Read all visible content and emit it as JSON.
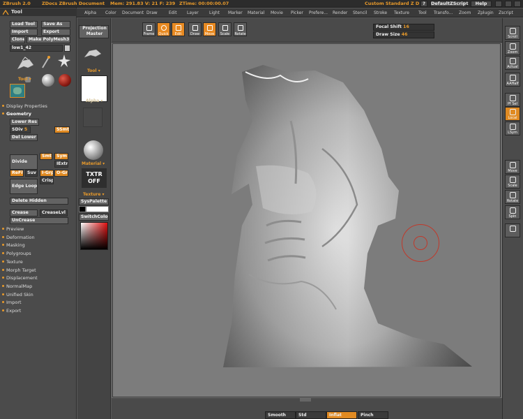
{
  "titlebar": {
    "app": "ZBrush 2.0",
    "doc_links": "ZDocs ZBrush Document",
    "mem": "Mem: 291.83  V: 21  F: 239",
    "ztime": "ZTime: 00:00:00.07",
    "custom": "Custom Standard Z D",
    "help_q": "?",
    "zscript": "DefaultZScript",
    "help": "Help"
  },
  "menu": [
    "Alpha",
    "Color",
    "Document",
    "Draw",
    "Edit",
    "Layer",
    "Light",
    "Marker",
    "Material",
    "Movie",
    "Picker",
    "Prefere...",
    "Render",
    "Stencil",
    "Stroke",
    "Texture",
    "Tool",
    "Transfo...",
    "Zoom",
    "Zplugin",
    "Zscript"
  ],
  "tool": {
    "title": "Tool",
    "load": "Load Tool",
    "save": "Save As",
    "import": "Import",
    "export": "Export",
    "clone": "Clone",
    "make_poly": "Make PolyMesh3D",
    "current_tool": "low1_42",
    "sections_top": [
      "Display Properties",
      "Geometry"
    ],
    "lower_res": "Lower Res",
    "sdiv_label": "SDiv",
    "sdiv_value": "5",
    "smt": "SSmt",
    "del_lower": "Del Lower",
    "divide": "Divide",
    "smt_btn": "Smt",
    "sym": "Sym",
    "iextr": "IExtr",
    "refit": "ReFit",
    "suv": "Suv",
    "igrp": "I-Grp",
    "ogrp": "O-Grp",
    "edge_loop": "Edge Loop",
    "crisp": "Crisp",
    "delete_hidden": "Delete Hidden",
    "crease": "Crease",
    "crease_lvl": "CreaseLvl",
    "uncrease": "UnCrease",
    "sections_bottom": [
      "Preview",
      "Deformation",
      "Masking",
      "Polygroups",
      "Texture",
      "Morph Target",
      "Displacement",
      "NormalMap",
      "Unified Skin",
      "Import",
      "Export"
    ]
  },
  "shelf": {
    "projection": "Projection Master",
    "tool_label": "Tool",
    "alpha_label": "Alpha",
    "material_label": "Material",
    "txtr_off": "TXTR OFF",
    "texture_label": "Texture",
    "syspalette": "SysPalette",
    "switchcolor": "SwitchColor"
  },
  "topbar": {
    "buttons": [
      {
        "name": "frame",
        "label": "Frame"
      },
      {
        "name": "quick",
        "label": "Quick"
      },
      {
        "name": "edit",
        "label": "Edit"
      },
      {
        "name": "draw",
        "label": "Draw"
      },
      {
        "name": "move",
        "label": "Move"
      },
      {
        "name": "scale",
        "label": "Scale"
      },
      {
        "name": "rotate",
        "label": "Rotate"
      }
    ],
    "focal_label": "Focal Shift",
    "focal_value": "16",
    "draw_label": "Draw Size",
    "draw_value": "46"
  },
  "right": {
    "buttons": [
      {
        "name": "scroll",
        "label": "Scroll"
      },
      {
        "name": "zoom",
        "label": "Zoom"
      },
      {
        "name": "actual",
        "label": "Actual"
      },
      {
        "name": "aahalf",
        "label": "AAHalf"
      },
      {
        "name": "pfill",
        "label": "Pf Sel"
      },
      {
        "name": "local",
        "label": "Local"
      },
      {
        "name": "lsym",
        "label": "LSym"
      },
      {
        "name": "move",
        "label": "Move"
      },
      {
        "name": "scale",
        "label": "Scale"
      },
      {
        "name": "rotate",
        "label": "Rotate"
      },
      {
        "name": "spin",
        "label": "Spin"
      },
      {
        "name": "snapshot",
        "label": ""
      }
    ]
  },
  "brushes": [
    "Smooth",
    "Std",
    "Inflat",
    "Pinch"
  ],
  "colors": {
    "accent": "#e88a22",
    "panel": "#4b4b4b",
    "canvas": "#7c7c7c"
  }
}
